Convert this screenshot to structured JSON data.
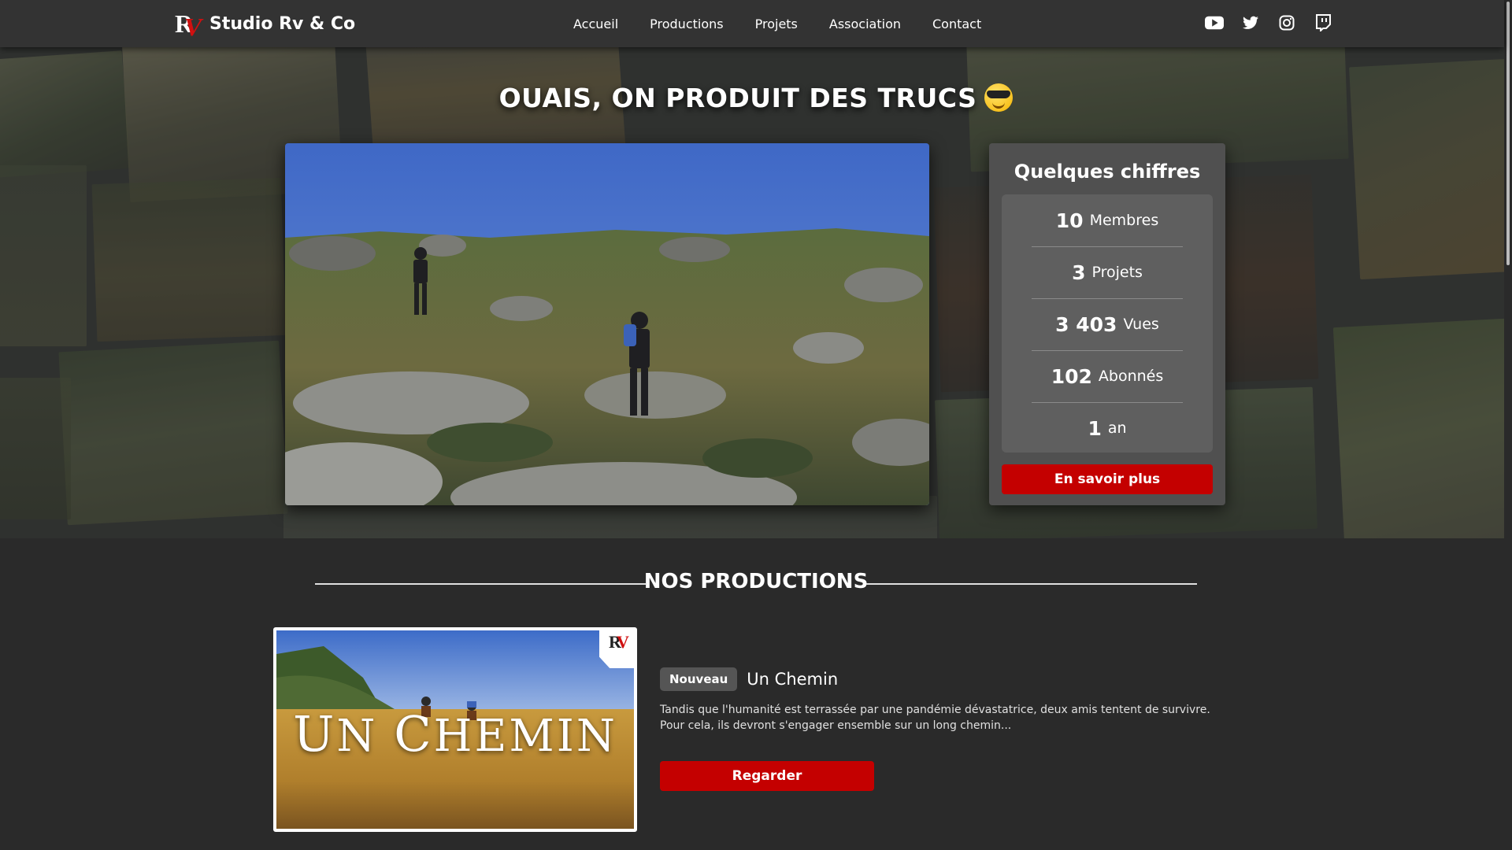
{
  "brand": {
    "name": "Studio Rv & Co",
    "logo_r": "R",
    "logo_v": "V"
  },
  "nav": {
    "items": [
      "Accueil",
      "Productions",
      "Projets",
      "Association",
      "Contact"
    ]
  },
  "social": {
    "icons": [
      "youtube-icon",
      "twitter-icon",
      "instagram-icon",
      "twitch-icon"
    ]
  },
  "hero": {
    "title": "OUAIS, ON PRODUIT DES TRUCS"
  },
  "stats": {
    "title": "Quelques chiffres",
    "rows": [
      {
        "value": "10",
        "label": "Membres"
      },
      {
        "value": "3",
        "label": "Projets"
      },
      {
        "value": "3 403",
        "label": "Vues"
      },
      {
        "value": "102",
        "label": "Abonnés"
      },
      {
        "value": "1",
        "label": "an"
      }
    ],
    "button": "En savoir plus"
  },
  "productions": {
    "title": "NOS PRODUCTIONS",
    "items": [
      {
        "badge": "Nouveau",
        "name": "Un Chemin",
        "thumb_title_first": "U",
        "thumb_title_rest1": "N ",
        "thumb_title_second": "C",
        "thumb_title_rest2": "HEMIN",
        "description": "Tandis que l'humanité est terrassée par une pandémie dévastatrice, deux amis tentent de survivre. Pour cela, ils devront s'engager ensemble sur un long chemin...",
        "button": "Regarder"
      }
    ]
  },
  "colors": {
    "accent": "#c40000",
    "navbar": "#333333",
    "page": "#2a2a2a"
  }
}
